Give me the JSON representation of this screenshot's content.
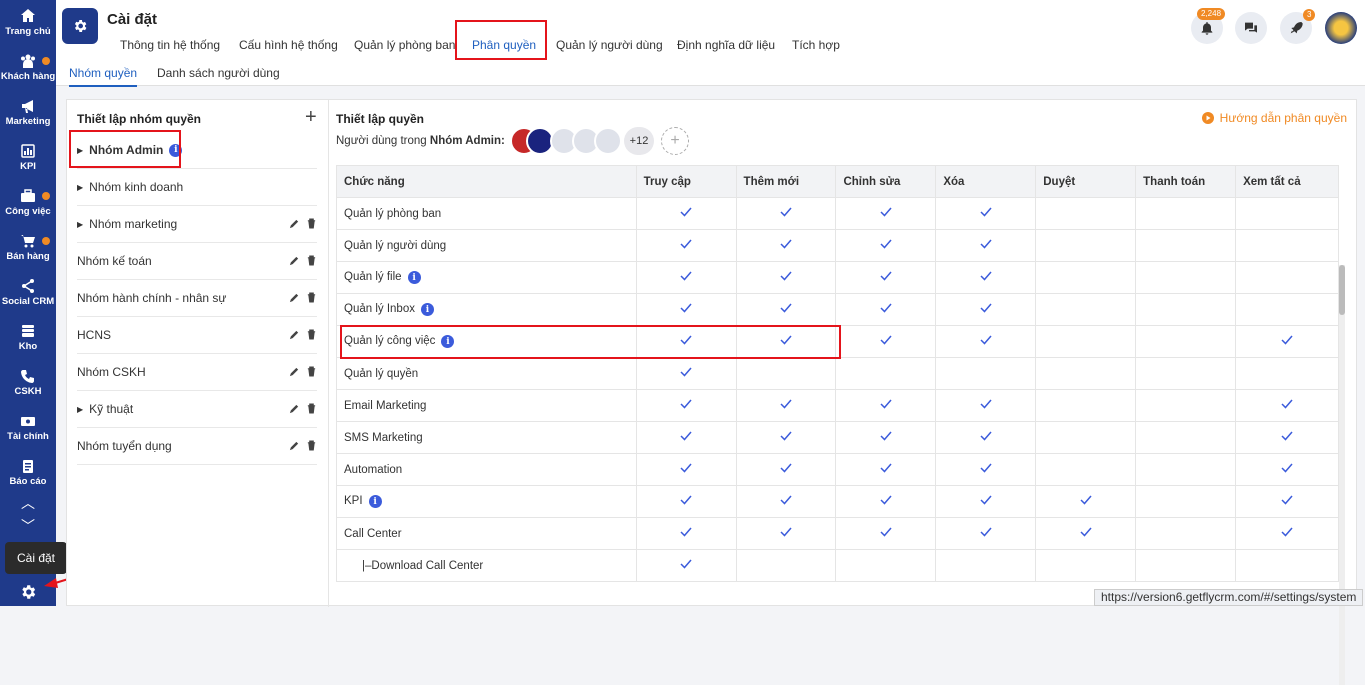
{
  "sidebar": {
    "items": [
      {
        "label": "Trang chủ",
        "icon": "home-icon",
        "dot": false
      },
      {
        "label": "Khách hàng",
        "icon": "customers-icon",
        "dot": true
      },
      {
        "label": "Marketing",
        "icon": "megaphone-icon",
        "dot": false
      },
      {
        "label": "KPI",
        "icon": "chart-icon",
        "dot": false
      },
      {
        "label": "Công việc",
        "icon": "briefcase-icon",
        "dot": true
      },
      {
        "label": "Bán hàng",
        "icon": "cart-icon",
        "dot": true
      },
      {
        "label": "Social CRM",
        "icon": "share-icon",
        "dot": false
      },
      {
        "label": "Kho",
        "icon": "warehouse-icon",
        "dot": false
      },
      {
        "label": "CSKH",
        "icon": "phone-icon",
        "dot": false
      },
      {
        "label": "Tài chính",
        "icon": "finance-icon",
        "dot": false
      },
      {
        "label": "Báo cáo",
        "icon": "report-icon",
        "dot": false
      }
    ],
    "tooltip": "Cài đặt"
  },
  "header": {
    "title": "Cài đặt",
    "tabs": [
      "Thông tin hệ thống",
      "Cấu hình hệ thống",
      "Quản lý phòng ban",
      "Phân quyền",
      "Quản lý người dùng",
      "Định nghĩa dữ liệu",
      "Tích hợp"
    ],
    "notification_count": "2,248",
    "rocket_count": "3"
  },
  "subtabs": [
    "Nhóm quyền",
    "Danh sách người dùng"
  ],
  "left": {
    "title": "Thiết lập nhóm quyền",
    "groups": [
      "Nhóm Admin",
      "Nhóm kinh doanh",
      "Nhóm marketing",
      "Nhóm kế toán",
      "Nhóm hành chính - nhân sự",
      "HCNS",
      "Nhóm CSKH",
      "Kỹ thuật",
      "Nhóm tuyển dụng"
    ]
  },
  "right": {
    "title": "Thiết lập quyền",
    "users_prefix": "Người dùng trong ",
    "users_group": "Nhóm Admin:",
    "more_users": "+12",
    "guide": "Hướng dẫn phân quyền",
    "columns": [
      "Chức năng",
      "Truy cập",
      "Thêm mới",
      "Chỉnh sửa",
      "Xóa",
      "Duyệt",
      "Thanh toán",
      "Xem tất cả"
    ],
    "rows": [
      {
        "name": "Quản lý phòng ban",
        "info": false,
        "checks": [
          1,
          1,
          1,
          1,
          0,
          0,
          0
        ]
      },
      {
        "name": "Quản lý người dùng",
        "info": false,
        "checks": [
          1,
          1,
          1,
          1,
          0,
          0,
          0
        ]
      },
      {
        "name": "Quản lý file",
        "info": true,
        "checks": [
          1,
          1,
          1,
          1,
          0,
          0,
          0
        ]
      },
      {
        "name": "Quản lý Inbox",
        "info": true,
        "checks": [
          1,
          1,
          1,
          1,
          0,
          0,
          0
        ]
      },
      {
        "name": "Quản lý công việc",
        "info": true,
        "checks": [
          1,
          1,
          1,
          1,
          0,
          0,
          1
        ]
      },
      {
        "name": "Quản lý quyền",
        "info": false,
        "checks": [
          1,
          0,
          0,
          0,
          0,
          0,
          0
        ]
      },
      {
        "name": "Email Marketing",
        "info": false,
        "checks": [
          1,
          1,
          1,
          1,
          0,
          0,
          1
        ]
      },
      {
        "name": "SMS Marketing",
        "info": false,
        "checks": [
          1,
          1,
          1,
          1,
          0,
          0,
          1
        ]
      },
      {
        "name": "Automation",
        "info": false,
        "checks": [
          1,
          1,
          1,
          1,
          0,
          0,
          1
        ]
      },
      {
        "name": "KPI",
        "info": true,
        "checks": [
          1,
          1,
          1,
          1,
          1,
          0,
          1
        ]
      },
      {
        "name": "Call Center",
        "info": false,
        "checks": [
          1,
          1,
          1,
          1,
          1,
          0,
          1
        ]
      },
      {
        "name": "|–Download Call Center",
        "info": false,
        "checks": [
          1,
          0,
          0,
          0,
          0,
          0,
          0
        ]
      }
    ]
  },
  "status_url": "https://version6.getflycrm.com/#/settings/system"
}
